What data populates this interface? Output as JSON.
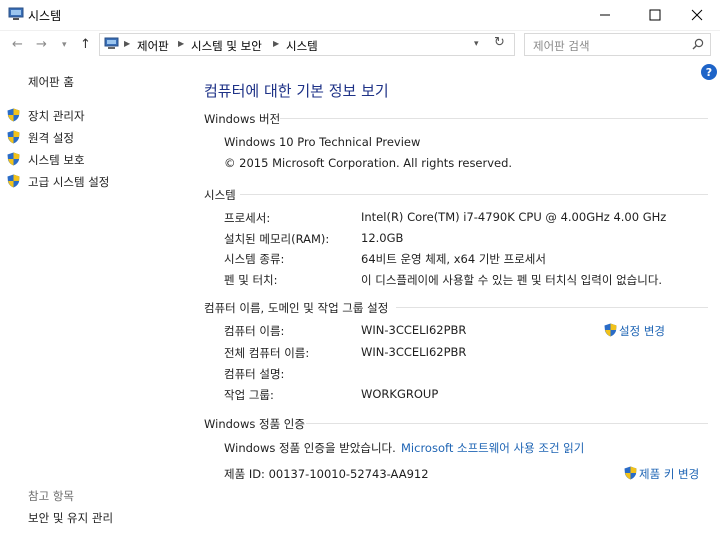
{
  "window": {
    "title": "시스템"
  },
  "address": {
    "crumbs": [
      "제어판",
      "시스템 및 보안",
      "시스템"
    ]
  },
  "search": {
    "placeholder": "제어판 검색"
  },
  "sidebar": {
    "home": "제어판 홈",
    "links": [
      "장치 관리자",
      "원격 설정",
      "시스템 보호",
      "고급 시스템 설정"
    ],
    "see_also_title": "참고 항목",
    "see_also": [
      "보안 및 유지 관리"
    ]
  },
  "main": {
    "heading": "컴퓨터에 대한 기본 정보 보기",
    "windows_edition": {
      "title": "Windows 버전",
      "name": "Windows 10 Pro Technical Preview",
      "copyright": "© 2015 Microsoft Corporation. All rights reserved."
    },
    "system": {
      "title": "시스템",
      "rows": [
        {
          "label": "프로세서:",
          "value": "Intel(R) Core(TM) i7-4790K CPU @ 4.00GHz   4.00 GHz"
        },
        {
          "label": "설치된 메모리(RAM):",
          "value": "12.0GB"
        },
        {
          "label": "시스템 종류:",
          "value": "64비트 운영 체제, x64 기반 프로세서"
        },
        {
          "label": "펜 및 터치:",
          "value": "이 디스플레이에 사용할 수 있는 펜 및 터치식 입력이 없습니다."
        }
      ]
    },
    "computer_name": {
      "title": "컴퓨터 이름, 도메인 및 작업 그룹 설정",
      "change_link": "설정 변경",
      "rows": [
        {
          "label": "컴퓨터 이름:",
          "value": "WIN-3CCELI62PBR"
        },
        {
          "label": "전체 컴퓨터 이름:",
          "value": "WIN-3CCELI62PBR"
        },
        {
          "label": "컴퓨터 설명:",
          "value": ""
        },
        {
          "label": "작업 그룹:",
          "value": "WORKGROUP"
        }
      ]
    },
    "activation": {
      "title": "Windows 정품 인증",
      "status": "Windows 정품 인증을 받았습니다.",
      "license_link": "Microsoft 소프트웨어 사용 조건 읽기",
      "product_id": "제품 ID: 00137-10010-52743-AA912",
      "change_key_link": "제품 키 변경"
    }
  },
  "colors": {
    "heading": "#1e3287",
    "link": "#1e64b4",
    "accent": "#1e64c8"
  }
}
